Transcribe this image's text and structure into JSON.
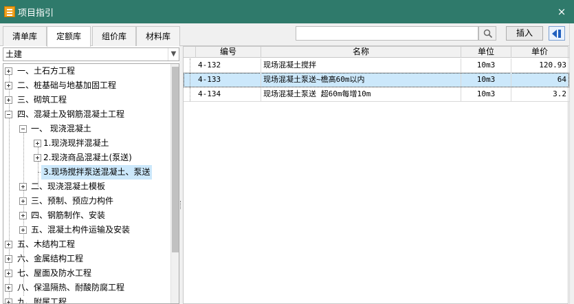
{
  "window": {
    "title": "项目指引",
    "close": "×"
  },
  "tabs": [
    {
      "label": "清单库"
    },
    {
      "label": "定额库"
    },
    {
      "label": "组价库"
    },
    {
      "label": "材料库"
    }
  ],
  "active_tab": "定额库",
  "toolbar": {
    "search_value": "",
    "insert_label": "插入"
  },
  "category": {
    "selected": "土建"
  },
  "tree": {
    "items": [
      {
        "label": "一、土石方工程",
        "expanded": false,
        "level": 0
      },
      {
        "label": "二、桩基础与地基加固工程",
        "expanded": false,
        "level": 0
      },
      {
        "label": "三、砌筑工程",
        "expanded": false,
        "level": 0
      },
      {
        "label": "四、混凝土及钢筋混凝土工程",
        "expanded": true,
        "level": 0
      },
      {
        "label": "一、 现浇混凝土",
        "expanded": true,
        "level": 1
      },
      {
        "label": "1.现浇现拌混凝土",
        "expanded": false,
        "level": 2
      },
      {
        "label": "2.现浇商品混凝土(泵送)",
        "expanded": false,
        "level": 2
      },
      {
        "label": "3.现场搅拌泵送混凝土、泵送",
        "expanded": null,
        "level": 2,
        "selected": true
      },
      {
        "label": "二、现浇混凝土模板",
        "expanded": false,
        "level": 1
      },
      {
        "label": "三、预制、预应力构件",
        "expanded": false,
        "level": 1
      },
      {
        "label": "四、钢筋制作、安装",
        "expanded": false,
        "level": 1
      },
      {
        "label": "五、混凝土构件运输及安装",
        "expanded": false,
        "level": 1
      },
      {
        "label": "五、木结构工程",
        "expanded": false,
        "level": 0
      },
      {
        "label": "六、金属结构工程",
        "expanded": false,
        "level": 0
      },
      {
        "label": "七、屋面及防水工程",
        "expanded": false,
        "level": 0
      },
      {
        "label": "八、保温隔热、耐酸防腐工程",
        "expanded": false,
        "level": 0
      },
      {
        "label": "九、附属工程",
        "expanded": false,
        "level": 0
      }
    ]
  },
  "table": {
    "columns": [
      "编号",
      "名称",
      "单位",
      "单价"
    ],
    "rows": [
      {
        "code": "4-132",
        "name": "现场混凝土搅拌",
        "unit": "10m3",
        "price": "120.93"
      },
      {
        "code": "4-133",
        "name": "现场混凝土泵送~檐高60m以内",
        "unit": "10m3",
        "price": "64",
        "selected": true
      },
      {
        "code": "4-134",
        "name": "现场混凝土泵送 超60m每增10m",
        "unit": "10m3",
        "price": "3.2"
      }
    ]
  },
  "colors": {
    "titlebar": "#2f7a6b",
    "selection": "#cce8fb",
    "app_icon": "#f0a01e"
  },
  "icons": [
    "app-icon",
    "close-icon",
    "search-icon",
    "collapse-panel-icon",
    "dropdown-arrow-icon"
  ]
}
